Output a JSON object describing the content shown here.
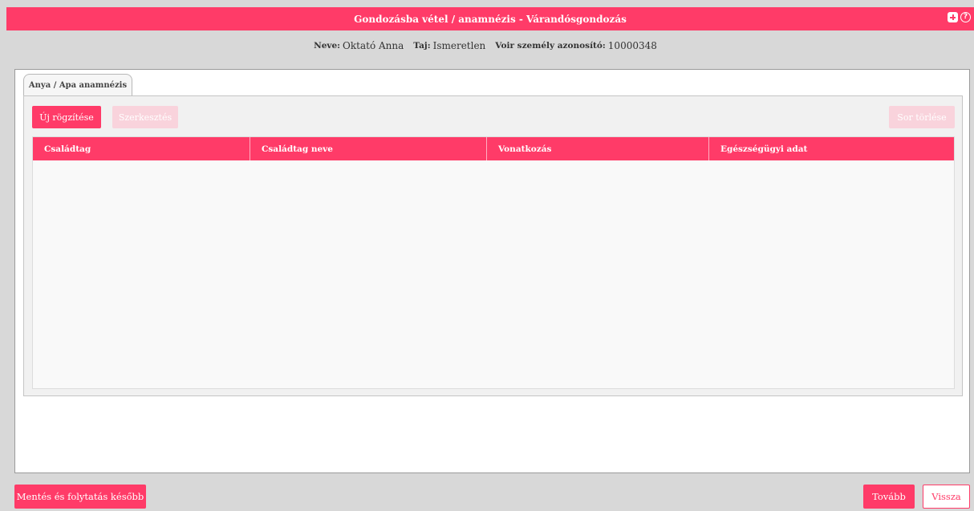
{
  "header": {
    "title": "Gondozásba vétel / anamnézis - Várandósgondozás",
    "icons": [
      "plus-square-icon",
      "help-circle-icon"
    ],
    "help_glyph": "?"
  },
  "patient": {
    "name_label": "Neve:",
    "name_value": "Oktató Anna",
    "taj_label": "Taj:",
    "taj_value": "Ismeretlen",
    "voir_label": "Voir személy azonosító:",
    "voir_value": "10000348"
  },
  "tabs": [
    {
      "label": "Anya / Apa anamnézis",
      "active": true
    }
  ],
  "toolbar": {
    "new_label": "Új rögzítése",
    "edit_label": "Szerkesztés",
    "delete_label": "Sor törlése"
  },
  "table": {
    "columns": [
      "Családtag",
      "Családtag neve",
      "Vonatkozás",
      "Egészségügyi adat"
    ],
    "rows": []
  },
  "footer": {
    "save_later_label": "Mentés és folytatás később",
    "next_label": "Tovább",
    "back_label": "Vissza"
  },
  "colors": {
    "accent": "#ff3b68",
    "accent_disabled": "#f9d3dc",
    "background": "#d8d8d8"
  }
}
